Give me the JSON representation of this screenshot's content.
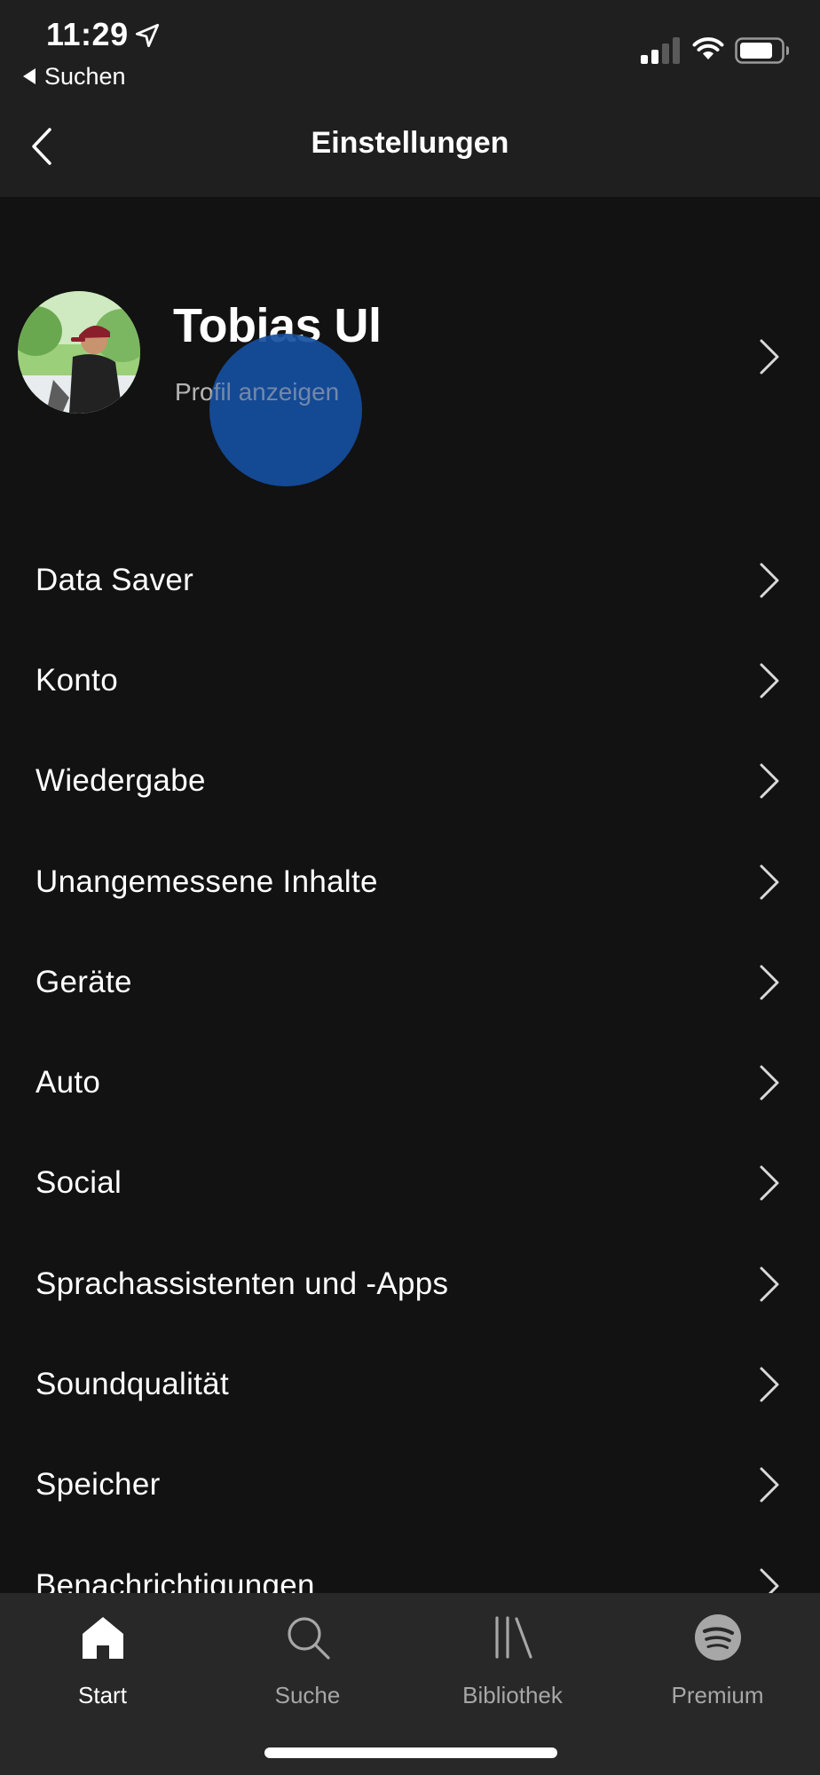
{
  "status_bar": {
    "time": "11:29",
    "back_to_app": "Suchen",
    "icons": [
      "location-arrow-icon",
      "cellular-signal-icon",
      "wifi-icon",
      "battery-icon"
    ]
  },
  "header": {
    "title": "Einstellungen",
    "back_icon": "chevron-left-icon"
  },
  "profile": {
    "name": "Tobias Ul",
    "subtitle": "Profil anzeigen"
  },
  "settings": {
    "items": [
      {
        "label": "Data Saver"
      },
      {
        "label": "Konto"
      },
      {
        "label": "Wiedergabe"
      },
      {
        "label": "Unangemessene Inhalte"
      },
      {
        "label": "Geräte"
      },
      {
        "label": "Auto"
      },
      {
        "label": "Social"
      },
      {
        "label": "Sprachassistenten und -Apps"
      },
      {
        "label": "Soundqualität"
      },
      {
        "label": "Speicher"
      },
      {
        "label": "Benachrichtigungen"
      }
    ]
  },
  "tabbar": {
    "tabs": [
      {
        "label": "Start",
        "icon": "home-icon",
        "active": true
      },
      {
        "label": "Suche",
        "icon": "search-icon",
        "active": false
      },
      {
        "label": "Bibliothek",
        "icon": "library-icon",
        "active": false
      },
      {
        "label": "Premium",
        "icon": "spotify-logo-icon",
        "active": false
      }
    ]
  },
  "colors": {
    "background": "#121212",
    "header_background": "#1f1f1f",
    "tabbar_background": "#282828",
    "text_primary": "#ffffff",
    "text_secondary": "#b3b3b3",
    "touch_indicator": "#154ea0"
  }
}
